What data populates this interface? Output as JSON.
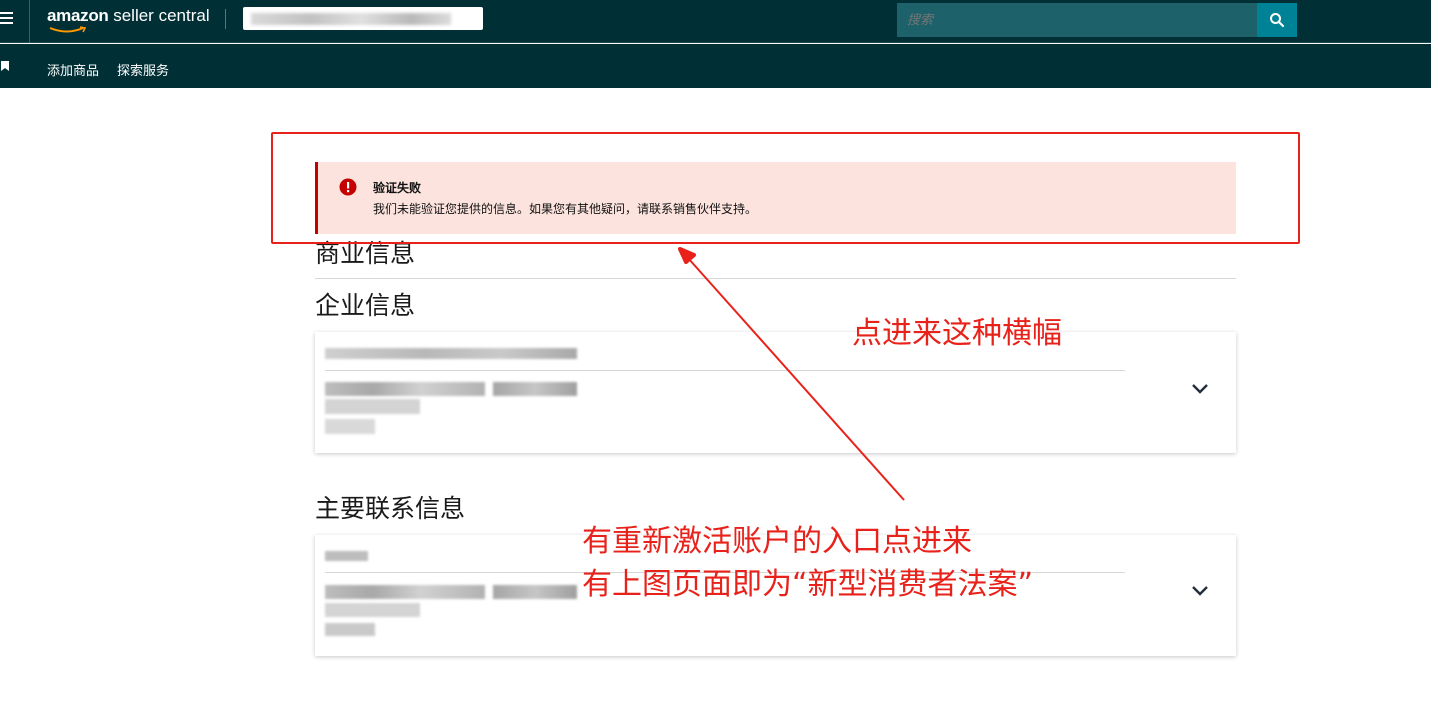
{
  "header": {
    "logo_amazon": "amazon",
    "logo_suffix": " seller central",
    "search_placeholder": "搜索",
    "brand_color": "#002f36",
    "search_button_color": "#008296"
  },
  "subnav": {
    "items": [
      {
        "label": "添加商品"
      },
      {
        "label": "探索服务"
      }
    ]
  },
  "alert": {
    "title": "验证失败",
    "message": "我们未能验证您提供的信息。如果您有其他疑问，请联系销售伙伴支持。",
    "color": "#c40000"
  },
  "sections": {
    "business_info": "商业信息",
    "company_info": "企业信息",
    "primary_contact": "主要联系信息"
  },
  "annotations": {
    "banner_note": "点进来这种横幅",
    "entry_note_line1": "有重新激活账户的入口点进来",
    "entry_note_line2": "有上图页面即为“新型消费者法案”",
    "color": "#e8221a"
  },
  "icons": {
    "menu": "hamburger-icon",
    "search": "search-icon",
    "bookmark": "bookmark-icon",
    "error": "error-icon",
    "expand": "chevron-down-icon"
  }
}
